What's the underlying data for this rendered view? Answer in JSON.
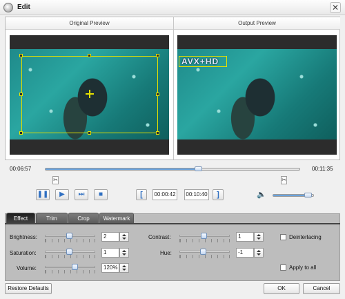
{
  "window": {
    "title": "Edit",
    "close_glyph": "✕"
  },
  "preview": {
    "original_title": "Original Preview",
    "output_title": "Output Preview",
    "watermark_text": "AVX+HD"
  },
  "playback": {
    "current_time": "00:06:57",
    "total_time": "00:11:35",
    "progress_fraction": 0.6,
    "start_time": "00:00:42",
    "end_time": "00:10:40",
    "volume_fraction": 0.85,
    "pause_icon": "❚❚",
    "play_icon": "▶",
    "next_frame_icon": "⏭",
    "stop_icon": "■",
    "bracket_open": "[",
    "bracket_close": "]",
    "scissor_icon": "✂",
    "volume_icon": "🔈"
  },
  "tabs": [
    {
      "label": "Effect",
      "active": true
    },
    {
      "label": "Trim",
      "active": false
    },
    {
      "label": "Crop",
      "active": false
    },
    {
      "label": "Watermark",
      "active": false
    }
  ],
  "effect": {
    "brightness": {
      "label": "Brightness:",
      "value": "2"
    },
    "saturation": {
      "label": "Saturation:",
      "value": "1"
    },
    "volume": {
      "label": "Volume:",
      "value": "120%"
    },
    "contrast": {
      "label": "Contrast:",
      "value": "1"
    },
    "hue": {
      "label": "Hue:",
      "value": "-1"
    },
    "deinterlacing_label": "Deinterlacing",
    "apply_all_label": "Apply to all"
  },
  "buttons": {
    "restore_defaults": "Restore Defaults",
    "ok": "OK",
    "cancel": "Cancel"
  }
}
